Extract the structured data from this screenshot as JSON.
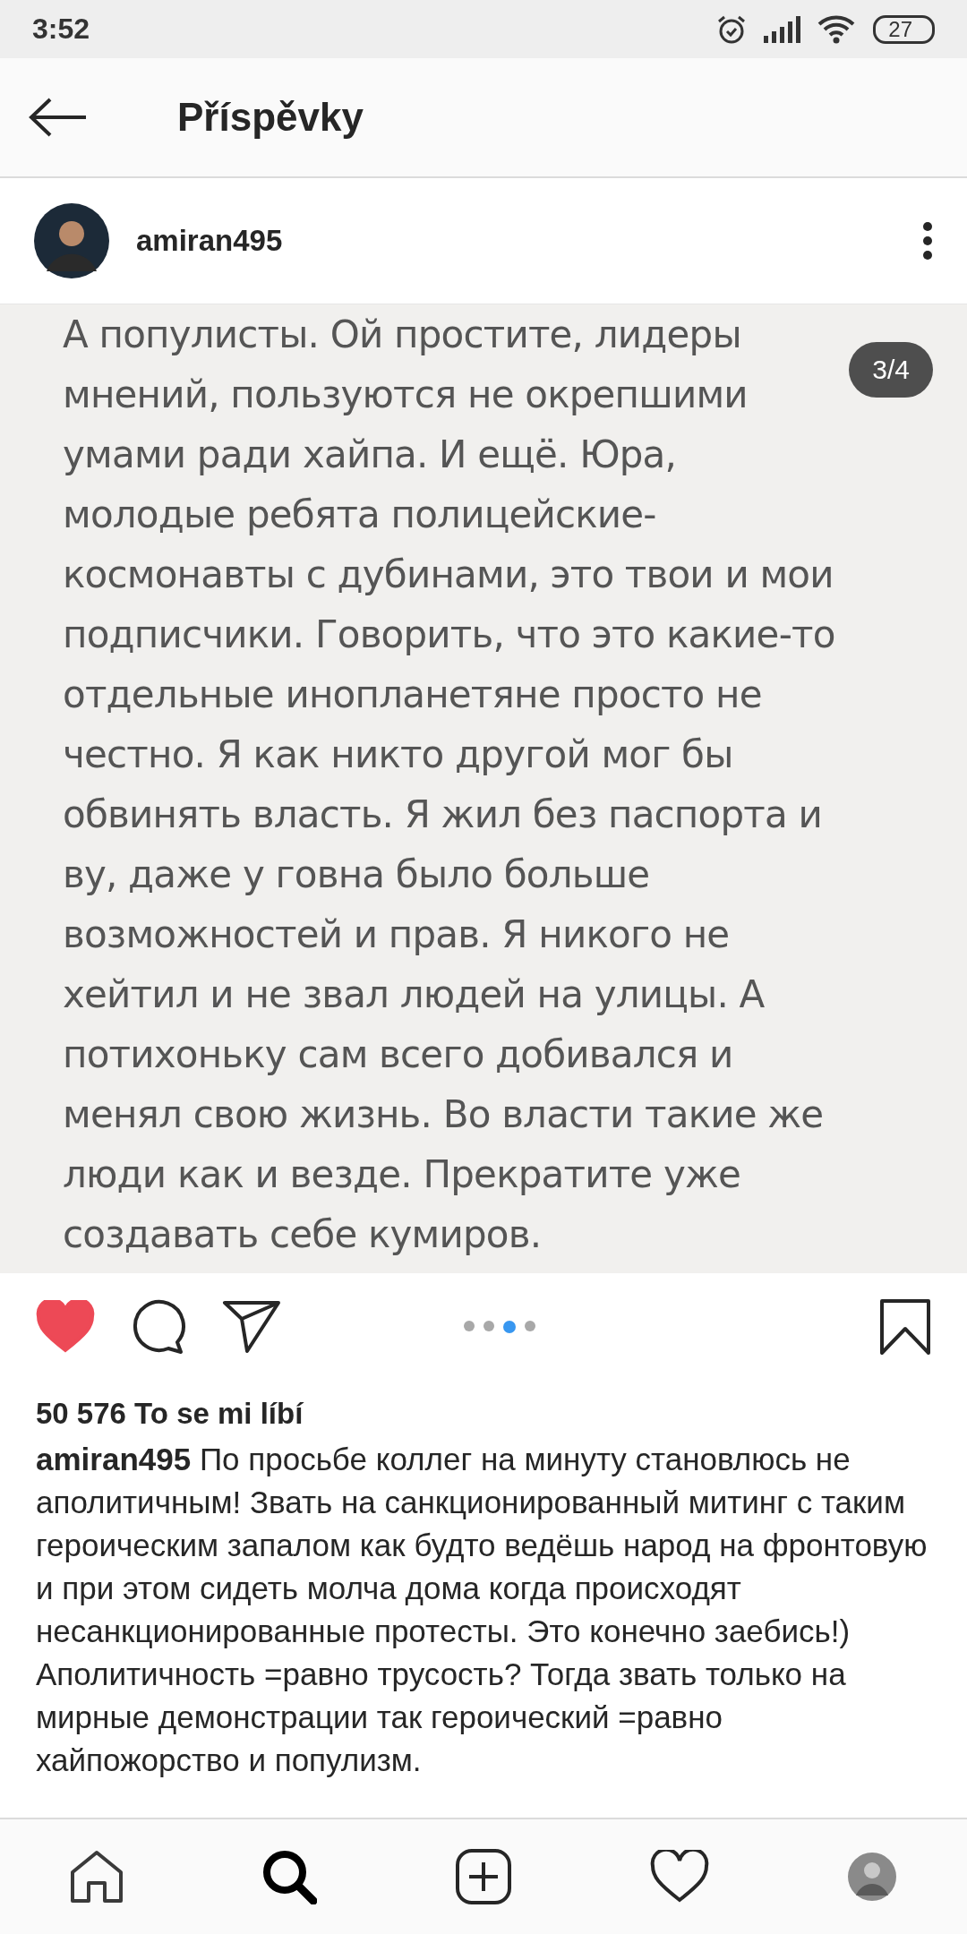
{
  "status_bar": {
    "time": "3:52",
    "battery": "27"
  },
  "header": {
    "title": "Příspěvky"
  },
  "post": {
    "username": "amiran495",
    "image_text": [
      "А популисты. Ой простите, лидеры",
      "мнений, пользуются не окрепшими",
      "умами ради хайпа. И ещё. Юра,",
      "молодые ребята полицейские-",
      "космонавты с дубинами, это твои и мои",
      "подписчики. Говорить, что это какие-то",
      "отдельные инопланетяне просто не",
      "честно. Я как никто другой мог бы",
      "обвинять власть. Я жил без паспорта и",
      "ву, даже у говна было больше",
      "возможностей и прав. Я никого не",
      "хейтил и не звал людей на улицы. А",
      "потихоньку сам всего добивался и",
      "менял свою жизнь. Во власти такие же",
      "люди как и везде. Прекратите уже",
      "создавать себе кумиров."
    ],
    "page_counter": "3/4",
    "liked": true,
    "dots": [
      {
        "selected": false
      },
      {
        "selected": false
      },
      {
        "selected": true
      },
      {
        "selected": false
      }
    ],
    "likes": "50 576 To se mi líbí",
    "caption_user": "amiran495",
    "caption": "По просьбе коллег на минуту становлюсь не аполитичным! Звать на санкционированный митинг с таким героическим запалом как будто ведёшь народ на фронтовую и при этом сидеть молча дома когда происходят несанкционированные протесты. Это конечно заебись!) Аполитичность =равно трусость? Тогда звать только на мирные демонстрации так героический =равно хайпожорство и популизм."
  },
  "nav": [
    {
      "kind": "home",
      "selected": false
    },
    {
      "kind": "search",
      "selected": true
    },
    {
      "kind": "add",
      "selected": false
    },
    {
      "kind": "activity",
      "selected": false
    },
    {
      "kind": "profile",
      "selected": false
    }
  ]
}
